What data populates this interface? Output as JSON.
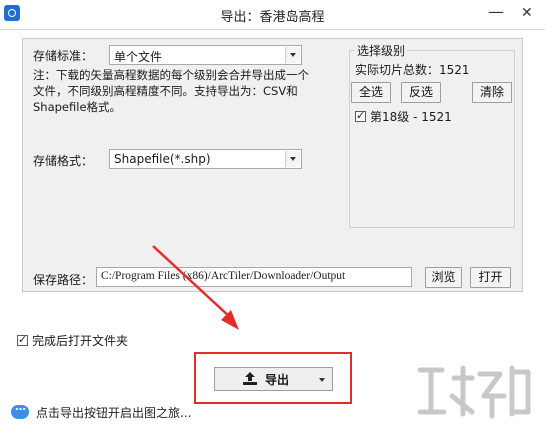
{
  "window": {
    "title": "导出：香港岛高程",
    "minimize_glyph": "—",
    "close_glyph": "✕",
    "icon": "app-logo-icon"
  },
  "storage_standard": {
    "label": "存储标准：",
    "value": "单个文件"
  },
  "note": "注：下载的矢量高程数据的每个级别会合并导出成一个文件，不同级别高程精度不同。支持导出为：CSV和Shapefile格式。",
  "storage_format": {
    "label": "存储格式：",
    "value": "Shapefile(*.shp)"
  },
  "levels": {
    "title": "选择级别",
    "total_label": "实际切片总数：1521",
    "select_all": "全选",
    "invert": "反选",
    "clear": "清除",
    "items": [
      {
        "label": "第18级 - 1521",
        "checked": true
      }
    ]
  },
  "save_path": {
    "label": "保存路径：",
    "value": "C:/Program Files (x86)/ArcTiler/Downloader/Output",
    "browse": "浏览",
    "open": "打开"
  },
  "open_folder_checkbox": {
    "label": "完成后打开文件夹",
    "checked": true
  },
  "export_button": {
    "label": "导出",
    "icon": "upload-icon"
  },
  "status": {
    "text": "点击导出按钮开启出图之旅...",
    "icon": "chat-bubble-icon"
  },
  "colors": {
    "highlight": "#e52d27",
    "panel": "#f0f0f0",
    "status_icon": "#3f8de6"
  }
}
